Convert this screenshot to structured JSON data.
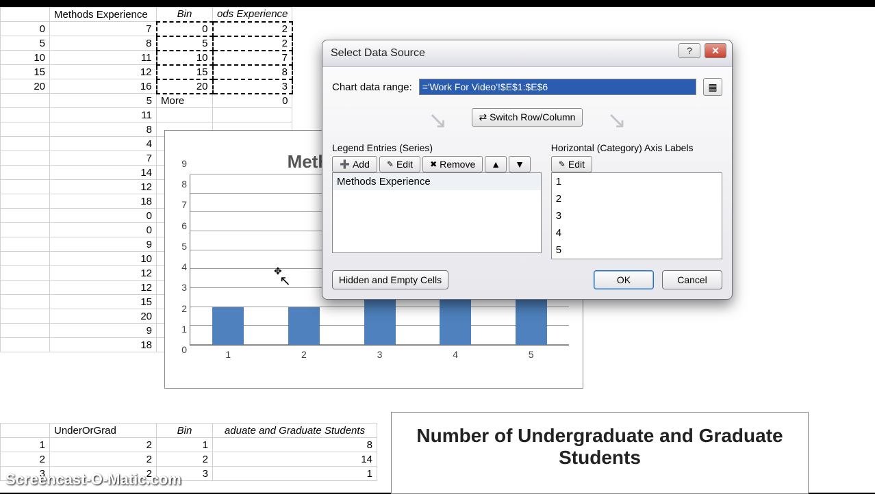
{
  "sheet1": {
    "headers": [
      "",
      "Methods Experience",
      "Bin",
      "ods Experience"
    ],
    "rows": [
      [
        "0",
        "7",
        "0",
        "2"
      ],
      [
        "5",
        "8",
        "5",
        "2"
      ],
      [
        "10",
        "11",
        "10",
        "7"
      ],
      [
        "15",
        "12",
        "15",
        "8"
      ],
      [
        "20",
        "16",
        "20",
        "3"
      ],
      [
        "",
        "5",
        "More",
        "0"
      ],
      [
        "",
        "11",
        "",
        ""
      ],
      [
        "",
        "8",
        "",
        ""
      ],
      [
        "",
        "4",
        "",
        ""
      ],
      [
        "",
        "7",
        "",
        ""
      ],
      [
        "",
        "14",
        "",
        ""
      ],
      [
        "",
        "12",
        "",
        ""
      ],
      [
        "",
        "18",
        "",
        ""
      ],
      [
        "",
        "0",
        "",
        ""
      ],
      [
        "",
        "0",
        "",
        ""
      ],
      [
        "",
        "9",
        "",
        ""
      ],
      [
        "",
        "10",
        "",
        ""
      ],
      [
        "",
        "12",
        "",
        ""
      ],
      [
        "",
        "12",
        "",
        ""
      ],
      [
        "",
        "15",
        "",
        ""
      ],
      [
        "",
        "20",
        "",
        ""
      ],
      [
        "",
        "9",
        "",
        ""
      ],
      [
        "",
        "18",
        "",
        ""
      ]
    ]
  },
  "bin_table": {
    "caption": "aduate and Graduate Students",
    "headers": [
      "",
      "UnderOrGrad",
      "Bin",
      ""
    ],
    "rows": [
      [
        "1",
        "2",
        "1",
        "8"
      ],
      [
        "2",
        "2",
        "2",
        "14"
      ],
      [
        "3",
        "2",
        "3",
        "1"
      ]
    ]
  },
  "chart_data": {
    "type": "bar",
    "title": "Methods Experience",
    "categories": [
      "1",
      "2",
      "3",
      "4",
      "5"
    ],
    "values": [
      2,
      2,
      7,
      8,
      3
    ],
    "ylim": [
      0,
      9
    ],
    "yticks": [
      0,
      1,
      2,
      3,
      4,
      5,
      6,
      7,
      8,
      9
    ],
    "series_name": "Methods Experience"
  },
  "chart2": {
    "title": "Number of Undergraduate and Graduate Students"
  },
  "dialog": {
    "title": "Select Data Source",
    "range_label": "Chart data range:",
    "range_value": "='Work For Video'!$E$1:$E$6",
    "switch_label": "Switch Row/Column",
    "legend_title": "Legend Entries (Series)",
    "axis_title": "Horizontal (Category) Axis Labels",
    "btn_add": "Add",
    "btn_edit": "Edit",
    "btn_remove": "Remove",
    "series_items": [
      "Methods Experience"
    ],
    "axis_items": [
      "1",
      "2",
      "3",
      "4",
      "5"
    ],
    "btn_hidden": "Hidden and Empty Cells",
    "btn_ok": "OK",
    "btn_cancel": "Cancel"
  },
  "watermark": "Screencast-O-Matic.com"
}
